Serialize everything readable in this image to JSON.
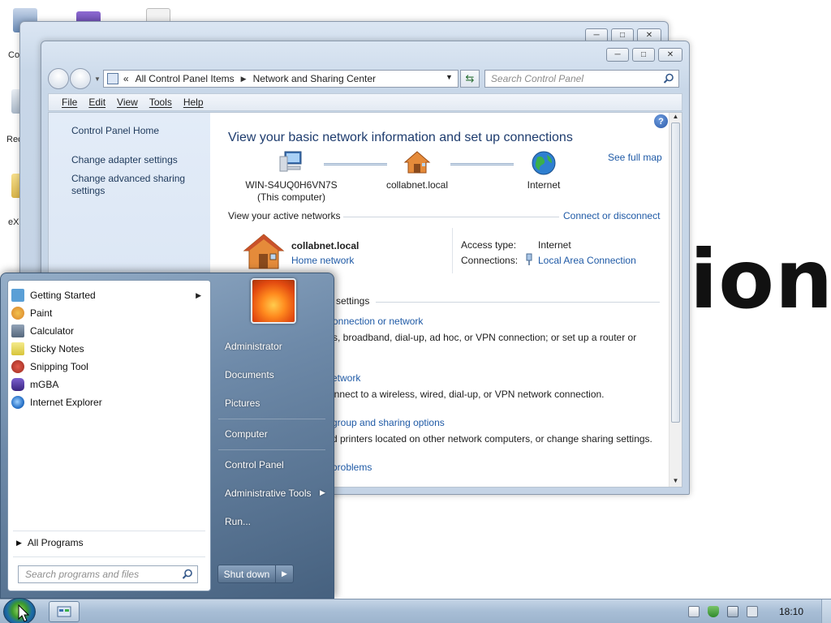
{
  "background": {
    "partial_text": "ion"
  },
  "desktop": {
    "labels": [
      "Co",
      "Rec",
      "eX"
    ]
  },
  "explorer": {
    "address": {
      "overflow": "«",
      "segments": [
        "All Control Panel Items",
        "Network and Sharing Center"
      ]
    },
    "search_placeholder": "Search Control Panel",
    "menu": [
      "File",
      "Edit",
      "View",
      "Tools",
      "Help"
    ],
    "left_pane": {
      "links": [
        "Control Panel Home",
        "Change adapter settings",
        "Change advanced sharing settings"
      ]
    },
    "main": {
      "heading": "View your basic network information and set up connections",
      "see_full_map": "See full map",
      "nodes": {
        "computer": {
          "name": "WIN-S4UQ0H6VN7S",
          "sub": "(This computer)"
        },
        "network": {
          "name": "collabnet.local"
        },
        "internet": {
          "name": "Internet"
        }
      },
      "active_networks_title": "View your active networks",
      "connect_or_disconnect": "Connect or disconnect",
      "active_network": {
        "name": "collabnet.local",
        "type": "Home network",
        "access_type_label": "Access type:",
        "access_type_value": "Internet",
        "connections_label": "Connections:",
        "connections_value": "Local Area Connection"
      },
      "settings_title_partial": "settings",
      "tasks": [
        {
          "title": "onnection or network",
          "desc": "ss, broadband, dial-up, ad hoc, or VPN connection; or set up a router or"
        },
        {
          "title": "etwork",
          "desc": "onnect to a wireless, wired, dial-up, or VPN network connection."
        },
        {
          "title": "group and sharing options",
          "desc": "d printers located on other network computers, or change sharing settings."
        },
        {
          "title": "problems",
          "desc": ""
        }
      ]
    }
  },
  "start_menu": {
    "programs": [
      {
        "label": "Getting Started",
        "icon": "getting-started-icon",
        "color": "#5a9fd6",
        "has_submenu": true
      },
      {
        "label": "Paint",
        "icon": "paint-icon",
        "color": "#e0a030",
        "has_submenu": false
      },
      {
        "label": "Calculator",
        "icon": "calculator-icon",
        "color": "#6b7f95",
        "has_submenu": false
      },
      {
        "label": "Sticky Notes",
        "icon": "sticky-notes-icon",
        "color": "#e8d84a",
        "has_submenu": false
      },
      {
        "label": "Snipping Tool",
        "icon": "snipping-tool-icon",
        "color": "#c0392b",
        "has_submenu": false
      },
      {
        "label": "mGBA",
        "icon": "mgba-icon",
        "color": "#5b3fa0",
        "has_submenu": false
      },
      {
        "label": "Internet Explorer",
        "icon": "internet-explorer-icon",
        "color": "#2a74c9",
        "has_submenu": false
      }
    ],
    "all_programs": "All Programs",
    "search_placeholder": "Search programs and files",
    "right_items": [
      "Administrator",
      "Documents",
      "Pictures",
      "Computer",
      "Control Panel",
      "Administrative Tools",
      "Run..."
    ],
    "shutdown_label": "Shut down"
  },
  "taskbar": {
    "clock": "18:10"
  },
  "colors": {
    "link": "#1f5aa6",
    "heading": "#1e3c6e",
    "taskbar": "#a8bed6"
  }
}
